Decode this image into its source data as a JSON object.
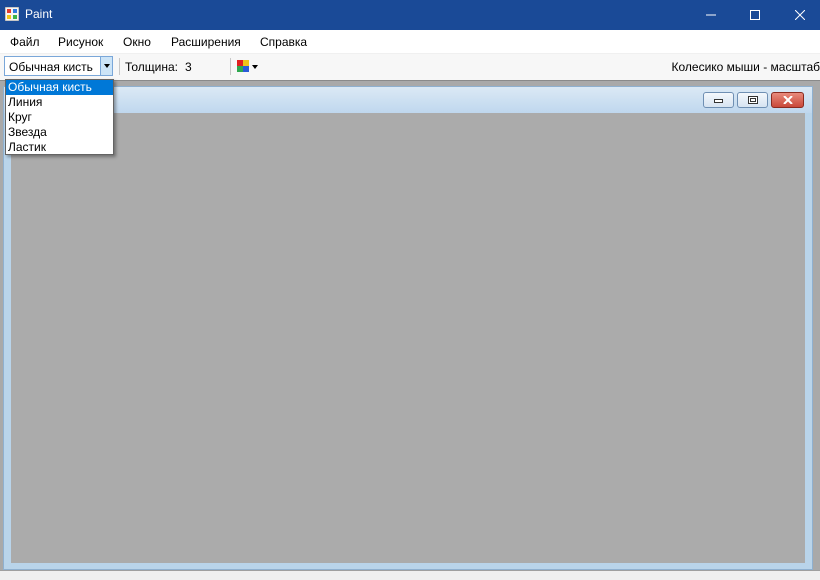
{
  "window": {
    "title": "Paint",
    "minimize_icon": "minimize-icon",
    "maximize_icon": "maximize-icon",
    "close_icon": "close-icon"
  },
  "menu": {
    "items": [
      "Файл",
      "Рисунок",
      "Окно",
      "Расширения",
      "Справка"
    ]
  },
  "toolbar": {
    "brush_selected": "Обычная кисть",
    "thickness_label": "Толщина:",
    "thickness_value": "3",
    "color_icon": "color-palette-icon",
    "hint": "Колесико мыши - масштаб"
  },
  "brush_dropdown": {
    "options": [
      "Обычная кисть",
      "Линия",
      "Круг",
      "Звезда",
      "Ластик"
    ],
    "selected_index": 0
  },
  "colors": {
    "titlebar": "#1a4a97",
    "selection": "#0078d7",
    "mdi_background": "#a9a9a9",
    "close_button": "#c9483a"
  }
}
